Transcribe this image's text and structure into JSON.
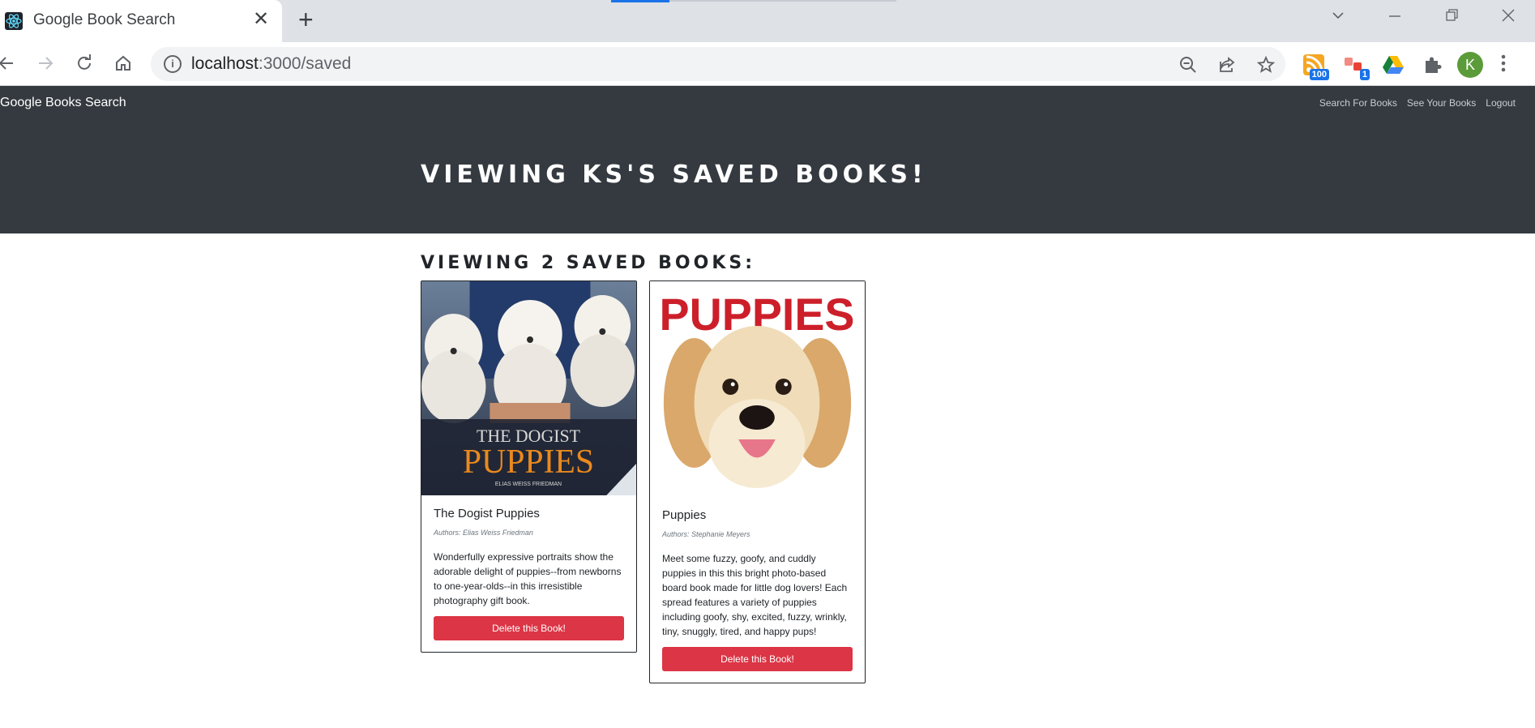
{
  "browser": {
    "tab_title": "Google Book Search",
    "tab_close": "✕",
    "new_tab": "+",
    "url_host": "localhost",
    "url_path": ":3000/saved",
    "extension_badges": [
      "100",
      "1"
    ],
    "profile_initial": "K"
  },
  "app": {
    "brand": "Google Books Search",
    "nav_links": [
      "Search For Books",
      "See Your Books",
      "Logout"
    ],
    "hero_title": "VIEWING KS'S SAVED BOOKS!",
    "section_title": "VIEWING 2 SAVED BOOKS:",
    "books": [
      {
        "title": "The Dogist Puppies",
        "authors": "Authors: Elias Weiss Friedman",
        "description": "Wonderfully expressive portraits show the adorable delight of puppies--from newborns to one-year-olds--in this irresistible photography gift book.",
        "cover_text_top": "THE DOGIST",
        "cover_text_main": "PUPPIES",
        "cover_text_author": "ELIAS WEISS FRIEDMAN",
        "delete_label": "Delete this Book!"
      },
      {
        "title": "Puppies",
        "authors": "Authors: Stephanie Meyers",
        "description": "Meet some fuzzy, goofy, and cuddly puppies in this this bright photo-based board book made for little dog lovers! Each spread features a variety of puppies including goofy, shy, excited, fuzzy, wrinkly, tiny, snuggly, tired, and happy pups!",
        "cover_text_main": "PUPPIES",
        "delete_label": "Delete this Book!"
      }
    ]
  },
  "colors": {
    "navbar": "#343a40",
    "danger": "#dc3545",
    "accent": "#1a73e8"
  }
}
